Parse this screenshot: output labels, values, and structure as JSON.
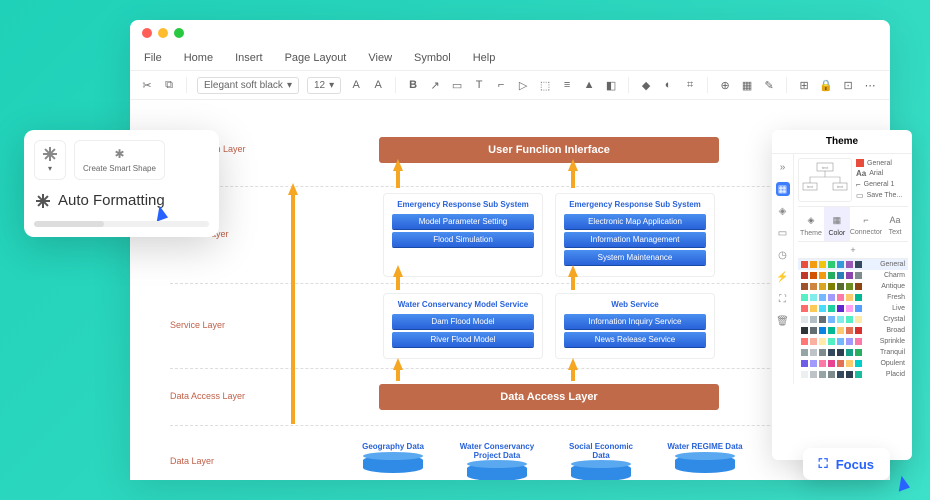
{
  "menu": {
    "file": "File",
    "home": "Home",
    "insert": "Insert",
    "page_layout": "Page Layout",
    "view": "View",
    "symbol": "Symbol",
    "help": "Help"
  },
  "toolbar": {
    "font": "Elegant soft black",
    "size": "12"
  },
  "layers": {
    "presentation": {
      "label": "Presentation Layer",
      "bar": "User Funclion Inlerface"
    },
    "business": {
      "label": "Business layer",
      "left": {
        "title": "Emergency Response  Sub System",
        "items": [
          "Model Parameter Setting",
          "Flood Simulation"
        ]
      },
      "right": {
        "title": "Emergency Response  Sub System",
        "items": [
          "Electronic Map Application",
          "Information Management",
          "System Maintenance"
        ]
      }
    },
    "service": {
      "label": "Service Layer",
      "left": {
        "title": "Water Conservancy Model Service",
        "items": [
          "Dam Flood Model",
          "River Flood Model"
        ]
      },
      "right": {
        "title": "Web Service",
        "items": [
          "Infornation Inquiry Service",
          "News Release Service"
        ]
      }
    },
    "data_access": {
      "label": "Data Access Layer",
      "bar": "Data Access Layer"
    },
    "data": {
      "label": "Data Layer",
      "cylinders": [
        "Geography Data",
        "Water Conservancy Project Data",
        "Social Economic Data",
        "Water REGIME Data"
      ]
    }
  },
  "theme": {
    "title": "Theme",
    "preview_items": [
      "General",
      "Arial",
      "General 1",
      "Save The..."
    ],
    "tabs": [
      "Theme",
      "Color",
      "Connector",
      "Text"
    ],
    "swatches": [
      {
        "name": "General",
        "colors": [
          "#e84c3d",
          "#f39c11",
          "#f1c40f",
          "#2ecc71",
          "#3498db",
          "#9b59b6",
          "#34495e"
        ]
      },
      {
        "name": "Charm",
        "colors": [
          "#c0392b",
          "#d35400",
          "#f39c11",
          "#27ae60",
          "#2980b9",
          "#8e44ad",
          "#7f8c8d"
        ]
      },
      {
        "name": "Antique",
        "colors": [
          "#a0522d",
          "#cd853f",
          "#daa520",
          "#808000",
          "#556b2f",
          "#6b8e23",
          "#8b4513"
        ]
      },
      {
        "name": "Fresh",
        "colors": [
          "#55efc4",
          "#81ecec",
          "#74b9ff",
          "#a29bfe",
          "#fd79a8",
          "#fdcb6e",
          "#00b894"
        ]
      },
      {
        "name": "Live",
        "colors": [
          "#ff6b6b",
          "#feca57",
          "#48dbfb",
          "#1dd1a1",
          "#5f27cd",
          "#ff9ff3",
          "#54a0ff"
        ]
      },
      {
        "name": "Crystal",
        "colors": [
          "#dfe6e9",
          "#b2bec3",
          "#636e72",
          "#74b9ff",
          "#81ecec",
          "#55efc4",
          "#ffeaa7"
        ]
      },
      {
        "name": "Broad",
        "colors": [
          "#2d3436",
          "#636e72",
          "#0984e3",
          "#00b894",
          "#fdcb6e",
          "#e17055",
          "#d63031"
        ]
      },
      {
        "name": "Sprinkle",
        "colors": [
          "#ff7675",
          "#fab1a0",
          "#ffeaa7",
          "#55efc4",
          "#74b9ff",
          "#a29bfe",
          "#fd79a8"
        ]
      },
      {
        "name": "Tranquil",
        "colors": [
          "#95a5a6",
          "#bdc3c7",
          "#7f8c8d",
          "#34495e",
          "#2c3e50",
          "#16a085",
          "#27ae60"
        ]
      },
      {
        "name": "Opulent",
        "colors": [
          "#6c5ce7",
          "#a29bfe",
          "#fd79a8",
          "#e84393",
          "#e17055",
          "#fdcb6e",
          "#00cec9"
        ]
      },
      {
        "name": "Placid",
        "colors": [
          "#ecf0f1",
          "#bdc3c7",
          "#95a5a6",
          "#7f8c8d",
          "#34495e",
          "#2c3e50",
          "#1abc9c"
        ]
      }
    ]
  },
  "af": {
    "smart": "Create Smart Shape",
    "auto": "Auto Formatting"
  },
  "focus": {
    "label": "Focus"
  }
}
